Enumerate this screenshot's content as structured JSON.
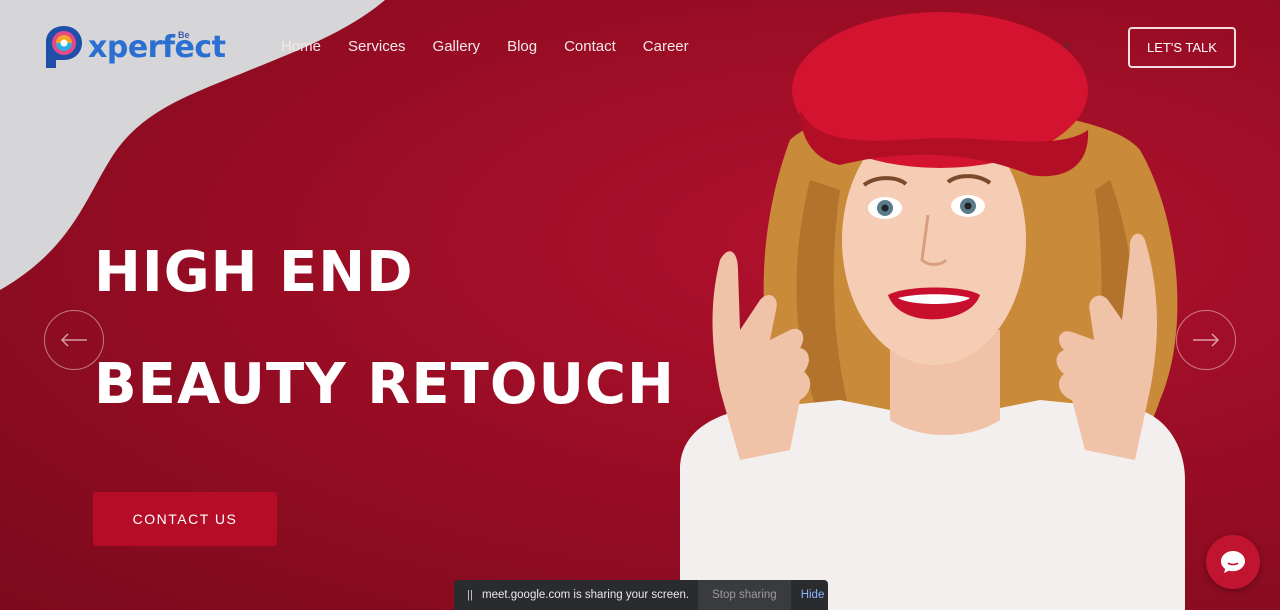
{
  "brand": {
    "name": "xperfect",
    "sub": "Be"
  },
  "nav": {
    "items": [
      "Home",
      "Services",
      "Gallery",
      "Blog",
      "Contact",
      "Career"
    ]
  },
  "social": {
    "icons": [
      "linkedin-icon",
      "instagram-icon",
      "twitter-icon"
    ]
  },
  "header": {
    "cta_label": "LET'S TALK"
  },
  "hero": {
    "headline_line1": "HIGH END",
    "headline_line2": "BEAUTY RETOUCH",
    "button_label": "CONTACT US"
  },
  "share_bar": {
    "pause": "||",
    "message": "meet.google.com is sharing your screen.",
    "stop_label": "Stop sharing",
    "hide_label": "Hide"
  },
  "colors": {
    "background": "#9a0d25",
    "accent": "#b50c28",
    "logo_blue": "#2a6fd1",
    "hat": "#d3132f"
  }
}
